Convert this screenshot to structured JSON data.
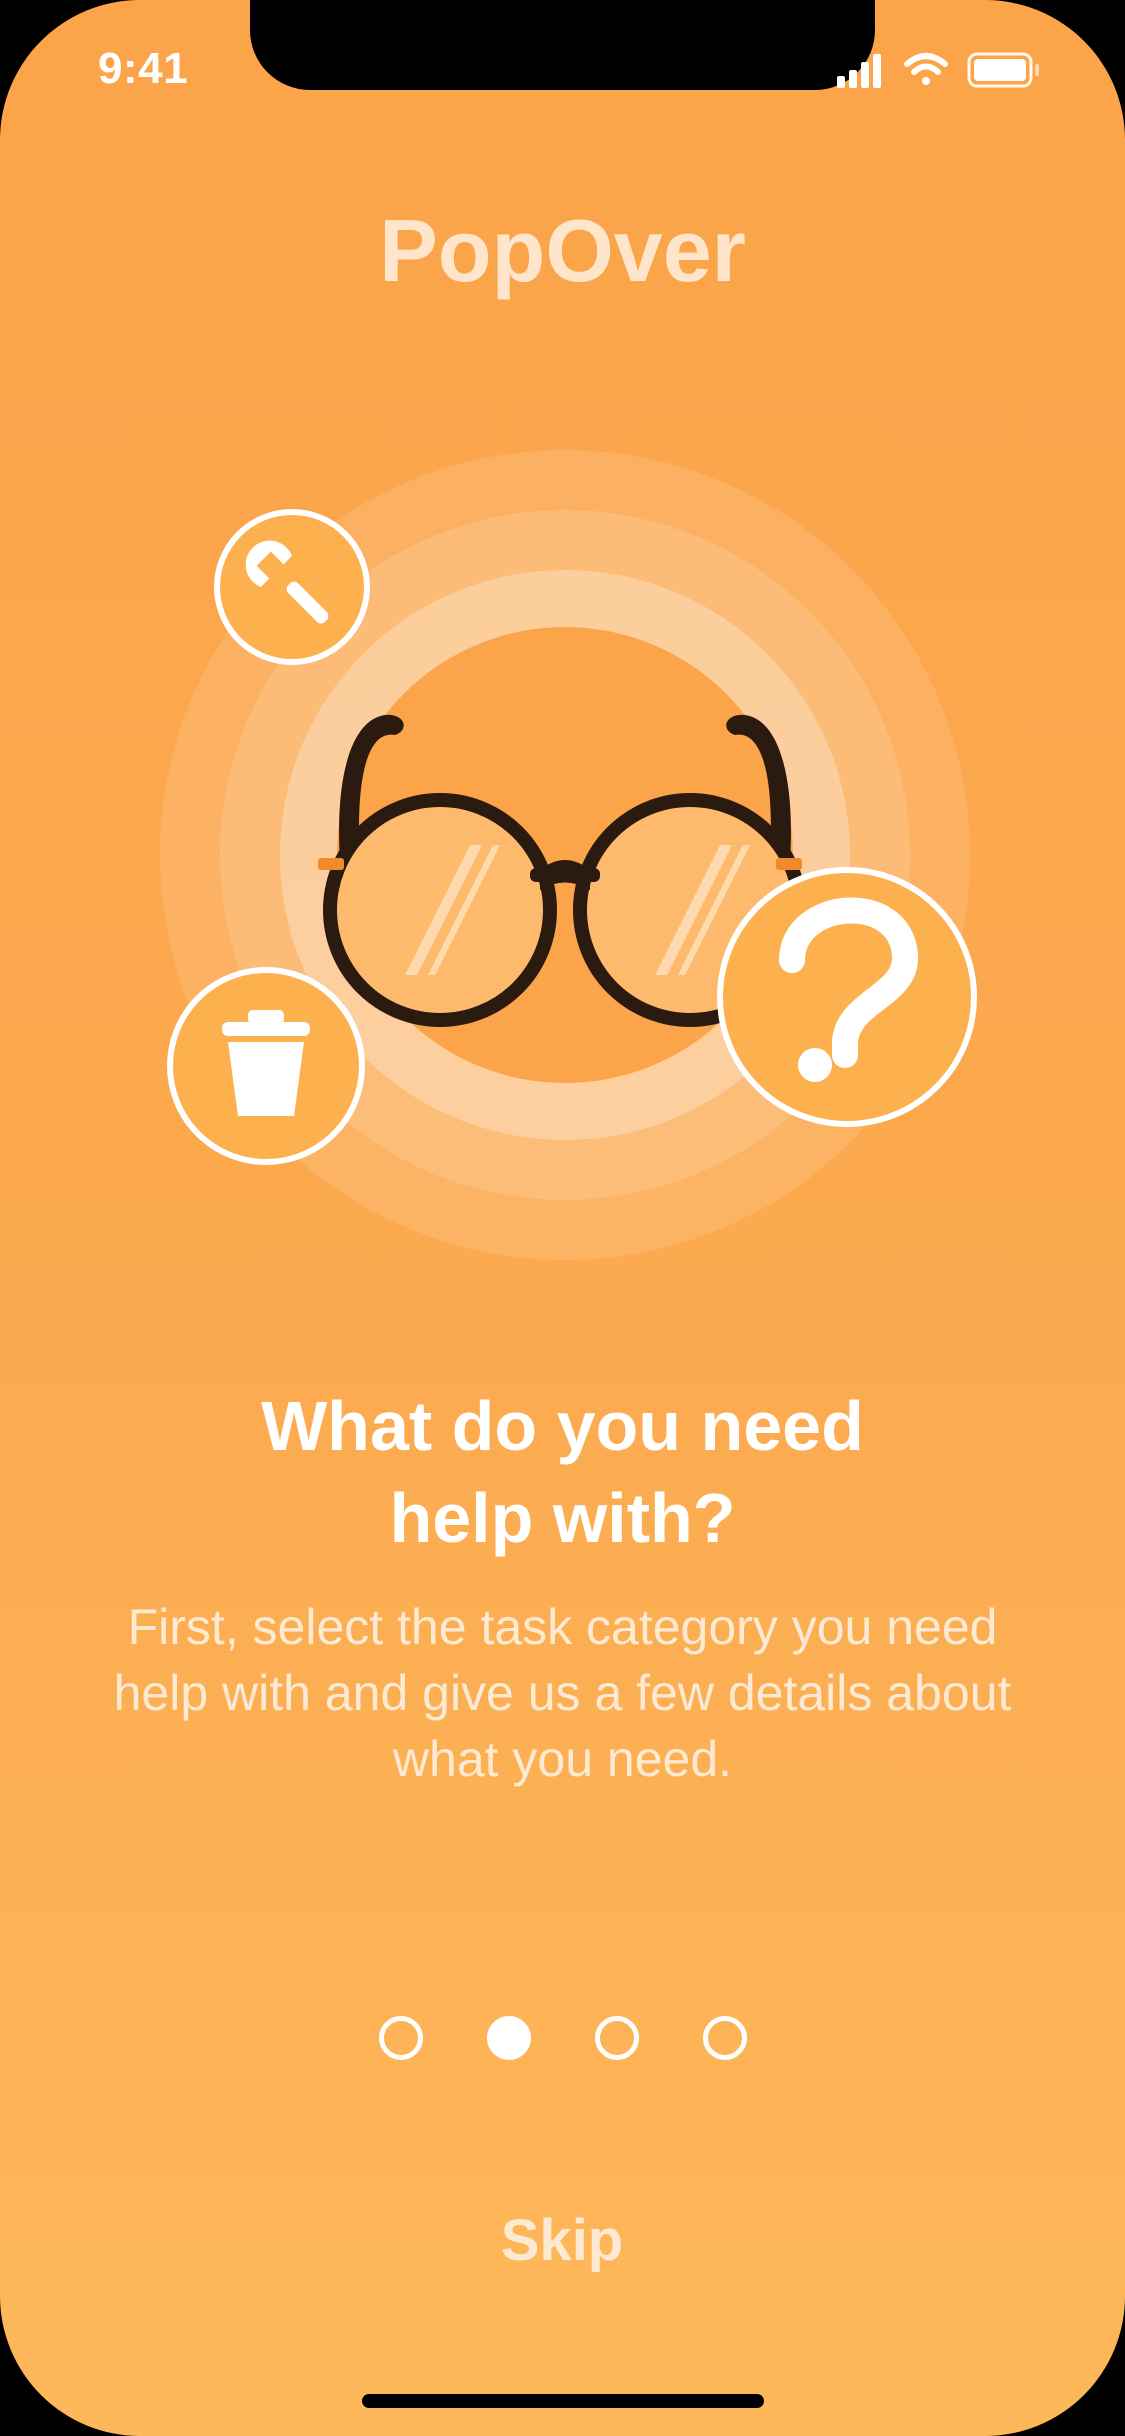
{
  "status_bar": {
    "time": "9:41",
    "icons": [
      "cellular-signal-icon",
      "wifi-icon",
      "battery-icon"
    ]
  },
  "app": {
    "title": "PopOver"
  },
  "illustration": {
    "icons": [
      "wrench-icon",
      "trash-icon",
      "question-icon",
      "glasses-icon"
    ]
  },
  "onboarding": {
    "heading_line1": "What do you need",
    "heading_line2": "help with?",
    "description_line1": "First, select the task category you need",
    "description_line2": "help with and give us a few details about",
    "description_line3": "what you need.",
    "current_page": 2,
    "total_pages": 4,
    "skip_label": "Skip"
  },
  "colors": {
    "background_top": "#FBA44A",
    "background_bottom": "#FDB85A",
    "title": "#FEE5CC",
    "glasses_frame": "#2A1A10"
  }
}
